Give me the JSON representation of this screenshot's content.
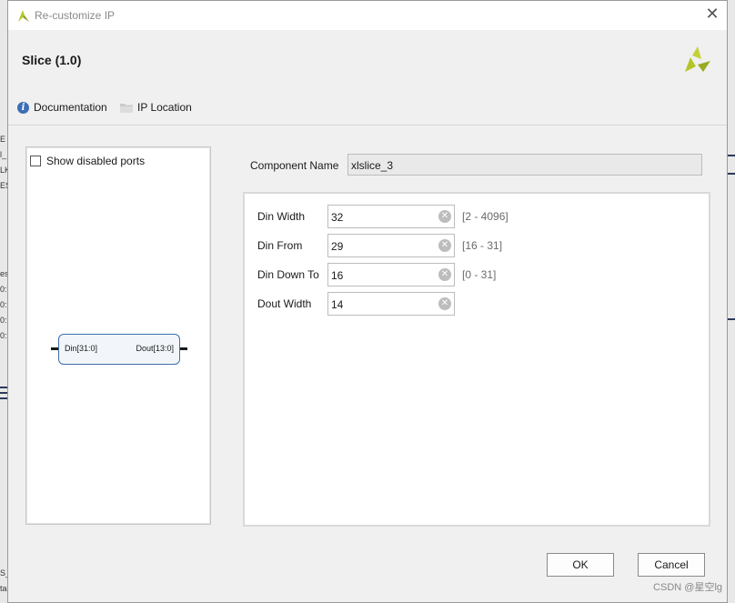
{
  "background": {
    "fragments": [
      "E",
      "l_",
      "LK",
      "ES",
      "es",
      "0:",
      "0:",
      "0:",
      "0:",
      "S_",
      "ta"
    ]
  },
  "dialog": {
    "title": "Re-customize IP",
    "close_icon": "close-icon",
    "ip_name": "Slice (1.0)",
    "documentation_label": "Documentation",
    "ip_location_label": "IP Location"
  },
  "symbol_panel": {
    "show_disabled_ports_label": "Show disabled ports",
    "show_disabled_ports_checked": false,
    "input_port": "Din[31:0]",
    "output_port": "Dout[13:0]"
  },
  "component": {
    "label": "Component Name",
    "value": "xlslice_3"
  },
  "params": [
    {
      "label": "Din Width",
      "value": "32",
      "range": "[2 - 4096]"
    },
    {
      "label": "Din From",
      "value": "29",
      "range": "[16 - 31]"
    },
    {
      "label": "Din Down To",
      "value": "16",
      "range": "[0 - 31]"
    },
    {
      "label": "Dout Width",
      "value": "14",
      "range": ""
    }
  ],
  "buttons": {
    "ok": "OK",
    "cancel": "Cancel"
  },
  "watermark": "CSDN @星空lg",
  "colors": {
    "brand_logo": "#b5c42a",
    "info_icon": "#3b6fb5",
    "symbol_border": "#3f6fa5"
  }
}
